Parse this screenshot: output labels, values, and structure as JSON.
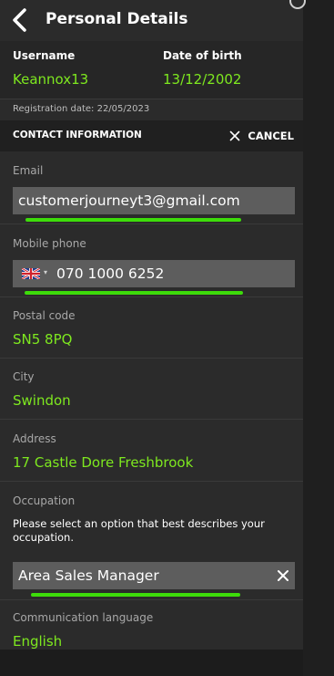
{
  "header": {
    "title": "Personal Details",
    "back_icon": "chevron-left-icon"
  },
  "user": {
    "username_label": "Username",
    "username": "Keannox13",
    "dob_label": "Date of birth",
    "dob": "13/12/2002",
    "registration_date": "Registration date: 22/05/2023"
  },
  "contact": {
    "title": "CONTACT INFORMATION",
    "cancel_label": "CANCEL",
    "cancel_icon": "close-icon"
  },
  "fields": {
    "email_label": "Email",
    "email_value": "customerjourneyt3@gmail.com",
    "mobile_label": "Mobile phone",
    "mobile_value": "070 1000 6252",
    "mobile_flag": "uk-flag-icon",
    "postal_label": "Postal code",
    "postal_value": "SN5 8PQ",
    "city_label": "City",
    "city_value": "Swindon",
    "address_label": "Address",
    "address_value": "17 Castle Dore Freshbrook",
    "occupation_label": "Occupation",
    "occupation_help": "Please select an option that best describes your occupation.",
    "occupation_value": "Area Sales Manager",
    "language_label": "Communication language",
    "language_value": "English"
  },
  "colors": {
    "accent_green": "#7ee81f",
    "underline_green": "#3ddc0a",
    "panel_bg": "#2b2b2b",
    "input_bg": "#5d5d5d"
  }
}
